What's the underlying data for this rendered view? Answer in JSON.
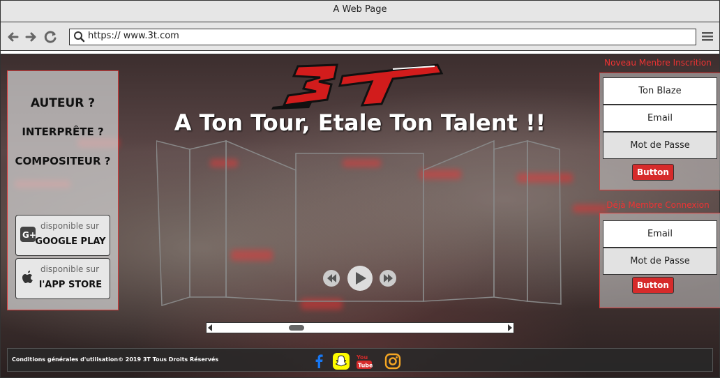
{
  "browser": {
    "title": "A Web Page",
    "url": "https:// www.3t.com"
  },
  "hero": {
    "logo_text": "3T",
    "tagline": "A Ton Tour, Etale Ton Talent !!"
  },
  "sidebar": {
    "roles": [
      "AUTEUR ?",
      "INTERPRÊTE ?",
      "COMPOSITEUR ?"
    ],
    "stores": [
      {
        "top": "disponible sur",
        "bottom": "GOOGLE PLAY",
        "icon": "google-plus-icon"
      },
      {
        "top": "disponible sur",
        "bottom": "l'APP STORE",
        "icon": "apple-icon"
      }
    ]
  },
  "register": {
    "title": "Noveau Menbre Inscrition",
    "fields": [
      "Ton Blaze",
      "Email",
      "Mot de Passe"
    ],
    "button": "Button"
  },
  "login": {
    "title": "Déjà Membre Connexion",
    "fields": [
      "Email",
      "Mot de Passe"
    ],
    "button": "Button"
  },
  "footer": {
    "text": "Conditions générales d'utilisation©   2019 3T Tous Droits Réservés",
    "social": [
      "facebook-icon",
      "snapchat-icon",
      "youtube-icon",
      "instagram-icon"
    ]
  },
  "colors": {
    "accent": "#d62b2b",
    "facebook": "#1877f2",
    "snapchat": "#fffc00",
    "youtube": "#d62b2b",
    "instagram": "#f5a623"
  }
}
